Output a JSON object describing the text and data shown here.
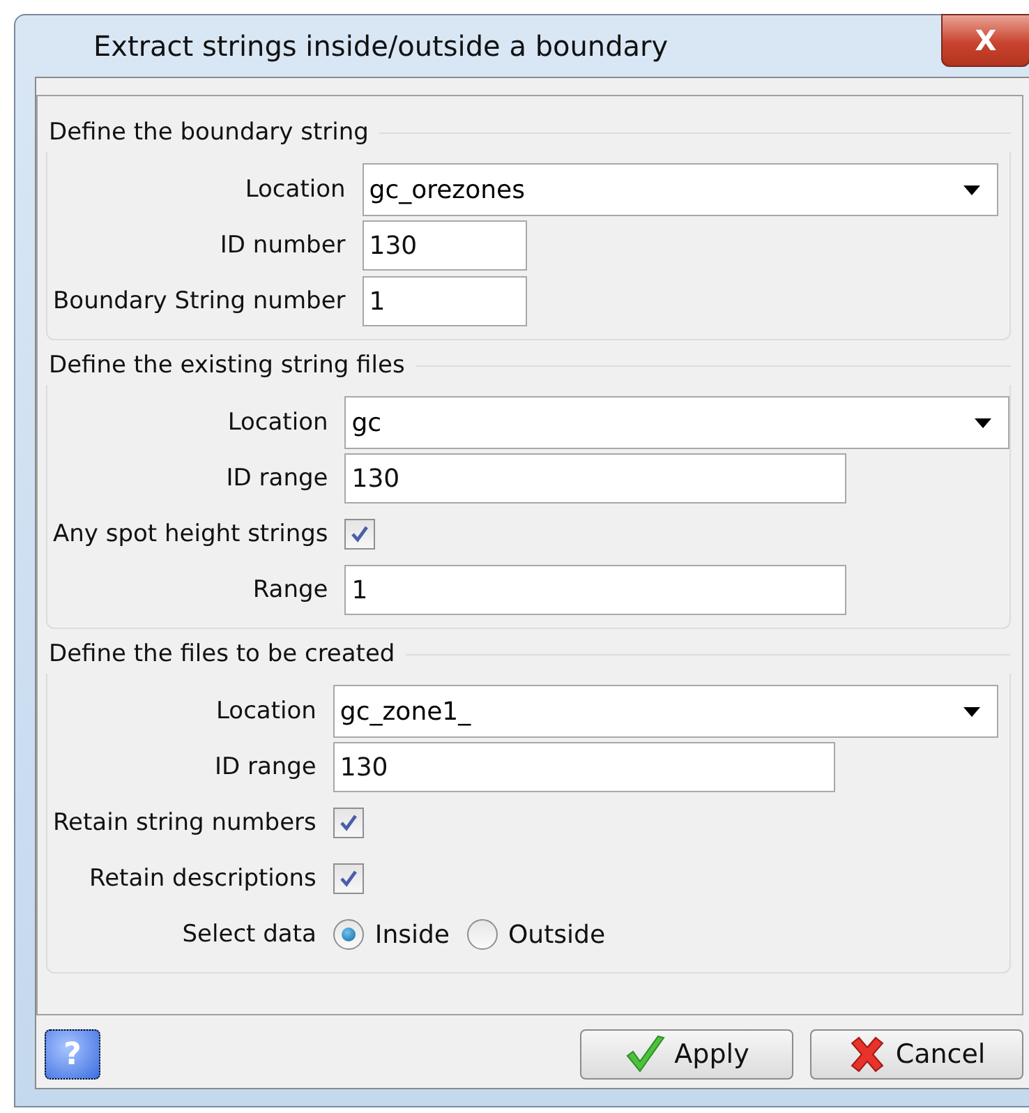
{
  "window": {
    "title": "Extract strings inside/outside a boundary",
    "close": "X"
  },
  "groups": [
    {
      "title": "Define the boundary string",
      "rows": [
        {
          "kind": "dropdown",
          "label": "Location",
          "value": "gc_orezones"
        },
        {
          "kind": "text",
          "label": "ID number",
          "value": "130"
        },
        {
          "kind": "text",
          "label": "Boundary String number",
          "value": "1"
        }
      ]
    },
    {
      "title": "Define the existing string files",
      "rows": [
        {
          "kind": "dropdown",
          "label": "Location",
          "value": "gc"
        },
        {
          "kind": "text",
          "label": "ID range",
          "value": "130"
        },
        {
          "kind": "checkbox",
          "label": "Any spot height strings",
          "checked": true
        },
        {
          "kind": "text",
          "label": "Range",
          "value": "1"
        }
      ]
    },
    {
      "title": "Define the files to be created",
      "rows": [
        {
          "kind": "dropdown",
          "label": "Location",
          "value": "gc_zone1_"
        },
        {
          "kind": "text",
          "label": "ID range",
          "value": "130"
        },
        {
          "kind": "checkbox",
          "label": "Retain string numbers",
          "checked": true
        },
        {
          "kind": "checkbox",
          "label": "Retain descriptions",
          "checked": true
        },
        {
          "kind": "radio",
          "label": "Select data",
          "options": [
            {
              "label": "Inside",
              "selected": true
            },
            {
              "label": "Outside",
              "selected": false
            }
          ]
        }
      ]
    }
  ],
  "help": "?",
  "buttons": [
    {
      "kind": "apply",
      "label": "Apply"
    },
    {
      "kind": "cancel",
      "label": "Cancel"
    }
  ]
}
